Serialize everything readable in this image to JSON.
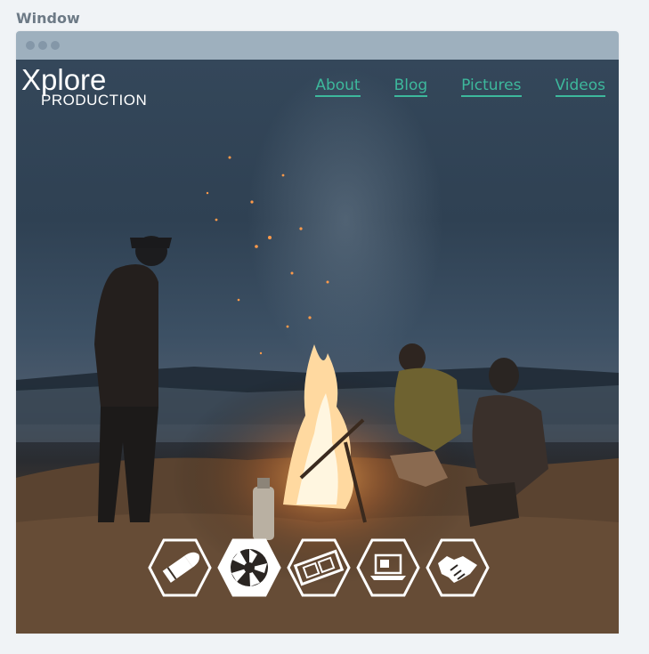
{
  "window_label": "Window",
  "logo": {
    "main": "Xplore",
    "sub": "PRODUCTION"
  },
  "nav": [
    {
      "label": "About"
    },
    {
      "label": "Blog"
    },
    {
      "label": "Pictures"
    },
    {
      "label": "Videos"
    }
  ],
  "icons": [
    "bullet-icon",
    "camera-shutter-icon",
    "film-strip-icon",
    "laptop-icon",
    "handshake-icon"
  ],
  "colors": {
    "accent": "#3db89c",
    "titlebar": "#9eb0be",
    "background": "#f0f3f6"
  }
}
